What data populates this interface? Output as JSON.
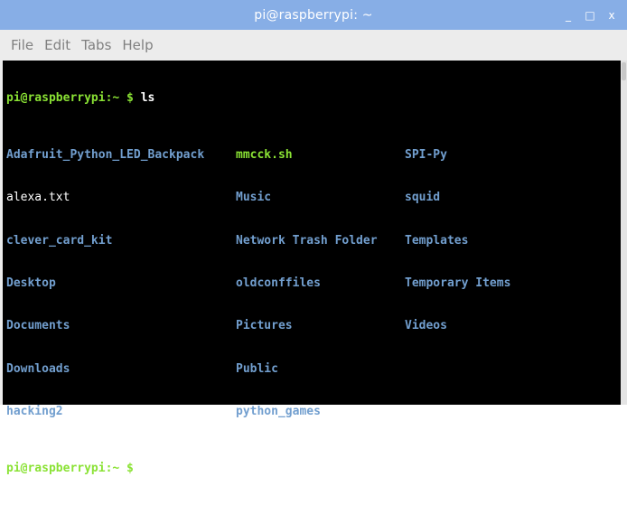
{
  "window": {
    "title": "pi@raspberrypi: ~",
    "controls": {
      "minimize": "_",
      "maximize": "□",
      "close": "x"
    }
  },
  "menu": [
    "File",
    "Edit",
    "Tabs",
    "Help"
  ],
  "terminal": {
    "prompt": "pi@raspberrypi:~ $",
    "command": " ls",
    "listing": {
      "col1": [
        {
          "name": "Adafruit_Python_LED_Backpack",
          "type": "dir"
        },
        {
          "name": "alexa.txt",
          "type": "file"
        },
        {
          "name": "clever_card_kit",
          "type": "dir"
        },
        {
          "name": "Desktop",
          "type": "dir"
        },
        {
          "name": "Documents",
          "type": "dir"
        },
        {
          "name": "Downloads",
          "type": "dir"
        },
        {
          "name": "hacking2",
          "type": "dir"
        }
      ],
      "col2": [
        {
          "name": "mmcck.sh",
          "type": "exe"
        },
        {
          "name": "Music",
          "type": "dir"
        },
        {
          "name": "Network Trash Folder",
          "type": "dir"
        },
        {
          "name": "oldconffiles",
          "type": "dir"
        },
        {
          "name": "Pictures",
          "type": "dir"
        },
        {
          "name": "Public",
          "type": "dir"
        },
        {
          "name": "python_games",
          "type": "dir"
        }
      ],
      "col3": [
        {
          "name": "SPI-Py",
          "type": "dir"
        },
        {
          "name": "squid",
          "type": "dir"
        },
        {
          "name": "Templates",
          "type": "dir"
        },
        {
          "name": "Temporary Items",
          "type": "dir"
        },
        {
          "name": "Videos",
          "type": "dir"
        }
      ]
    },
    "next_prompt": "pi@raspberrypi:~ $"
  },
  "colors": {
    "titlebar": "#87aee6",
    "prompt": "#8ae234",
    "directory": "#729fcf",
    "executable": "#8ae234",
    "background": "#000000"
  }
}
